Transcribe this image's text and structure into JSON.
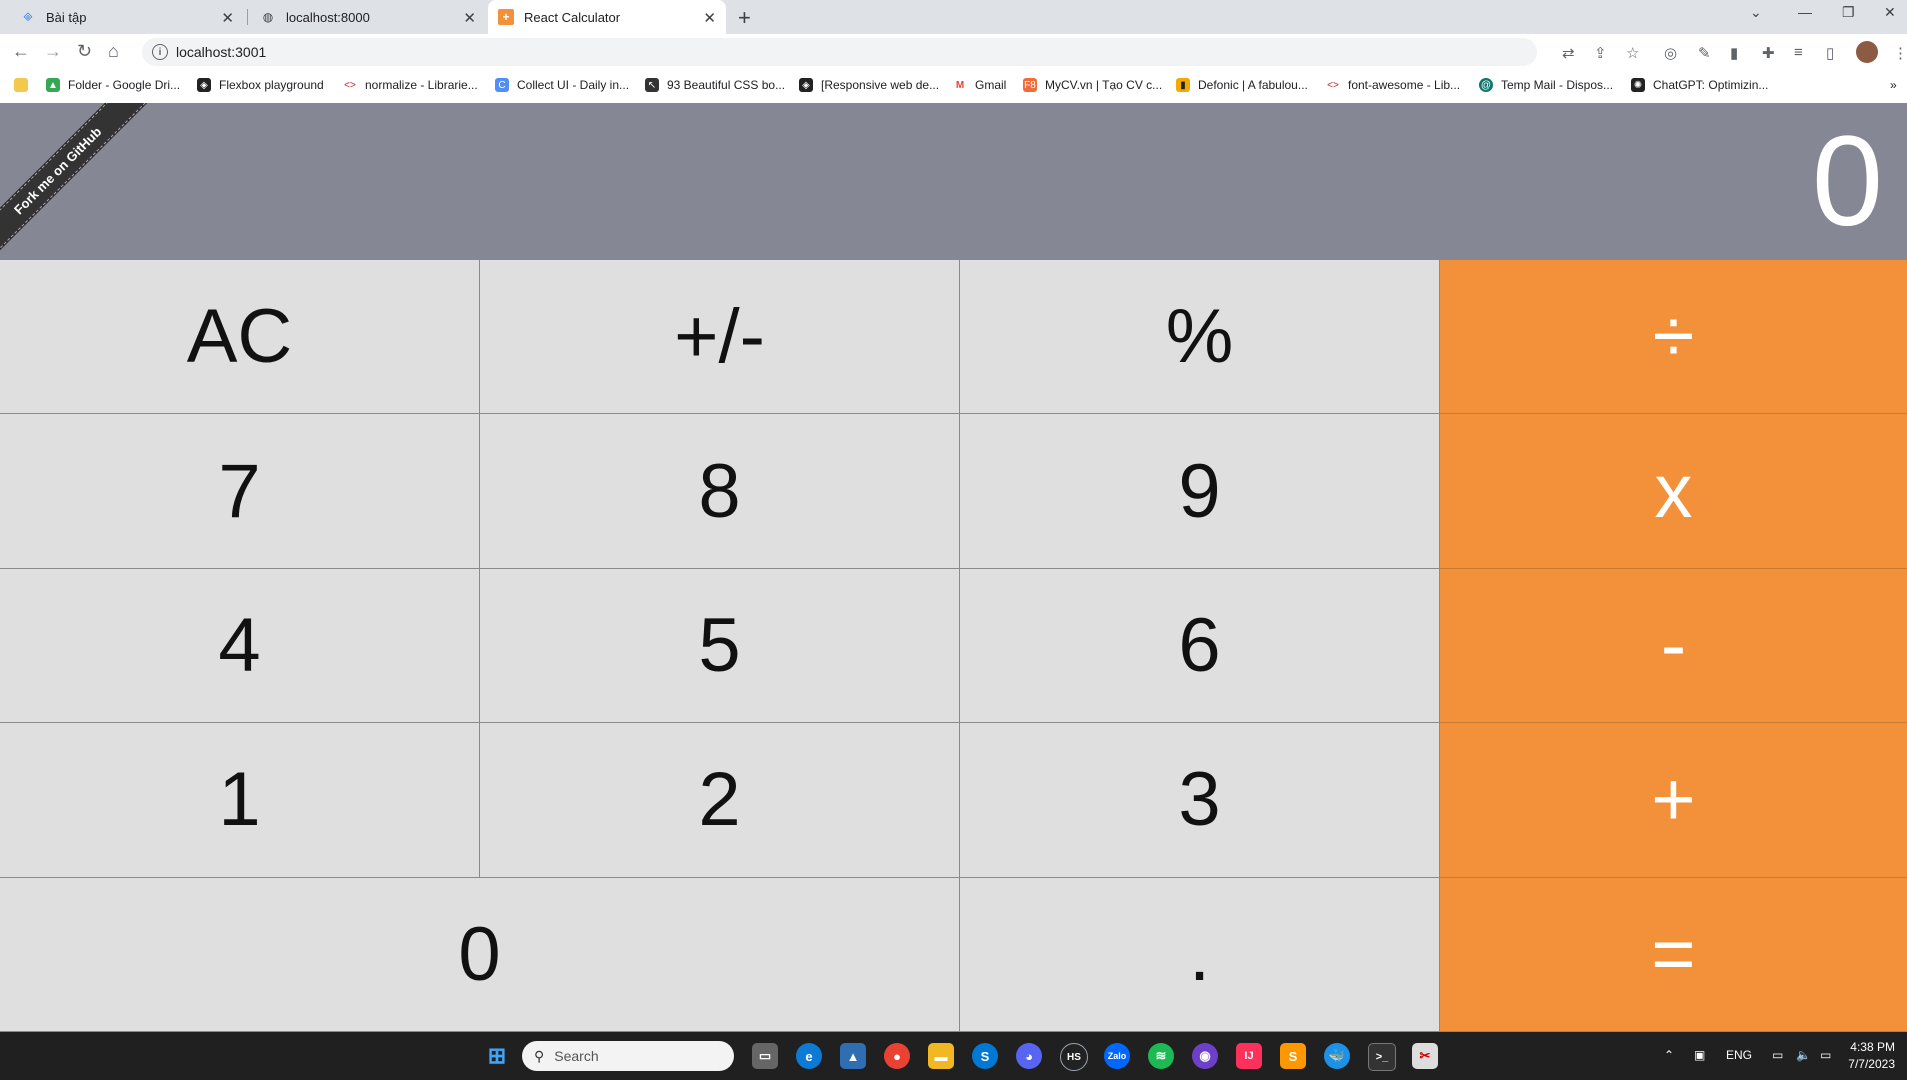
{
  "browser": {
    "tabs": [
      {
        "title": "Bài tập",
        "icon": "tree-icon",
        "active": false
      },
      {
        "title": "localhost:8000",
        "icon": "globe-icon",
        "active": false
      },
      {
        "title": "React Calculator",
        "icon": "calculator-icon",
        "active": true
      }
    ],
    "new_tab": "+",
    "address": "localhost:3001",
    "bookmarks": [
      {
        "label": "Folder - Google Dri...",
        "icon": "google-drive-icon"
      },
      {
        "label": "Flexbox playground",
        "icon": "flexbox-icon"
      },
      {
        "label": "normalize - Librarie...",
        "icon": "code-icon"
      },
      {
        "label": "Collect UI - Daily in...",
        "icon": "collectui-icon"
      },
      {
        "label": "93 Beautiful CSS bo...",
        "icon": "cursor-icon"
      },
      {
        "label": "[Responsive web de...",
        "icon": "flexbox-icon"
      },
      {
        "label": "Gmail",
        "icon": "gmail-icon"
      },
      {
        "label": "MyCV.vn | Tạo CV c...",
        "icon": "f8-icon"
      },
      {
        "label": "Defonic | A fabulou...",
        "icon": "defonic-icon"
      },
      {
        "label": "font-awesome - Lib...",
        "icon": "code-icon"
      },
      {
        "label": "Temp Mail - Dispos...",
        "icon": "tempmail-icon"
      },
      {
        "label": "ChatGPT: Optimizin...",
        "icon": "chatgpt-icon"
      }
    ]
  },
  "calculator": {
    "ribbon": "Fork me on GitHub",
    "display": "0",
    "keys": [
      {
        "label": "AC",
        "type": "func",
        "name": "clear-button"
      },
      {
        "label": "+/-",
        "type": "func",
        "name": "sign-toggle-button"
      },
      {
        "label": "%",
        "type": "func",
        "name": "percent-button"
      },
      {
        "label": "÷",
        "type": "op",
        "name": "divide-button"
      },
      {
        "label": "7",
        "type": "num",
        "name": "digit-7-button"
      },
      {
        "label": "8",
        "type": "num",
        "name": "digit-8-button"
      },
      {
        "label": "9",
        "type": "num",
        "name": "digit-9-button"
      },
      {
        "label": "x",
        "type": "op",
        "name": "multiply-button"
      },
      {
        "label": "4",
        "type": "num",
        "name": "digit-4-button"
      },
      {
        "label": "5",
        "type": "num",
        "name": "digit-5-button"
      },
      {
        "label": "6",
        "type": "num",
        "name": "digit-6-button"
      },
      {
        "label": "-",
        "type": "op",
        "name": "subtract-button"
      },
      {
        "label": "1",
        "type": "num",
        "name": "digit-1-button"
      },
      {
        "label": "2",
        "type": "num",
        "name": "digit-2-button"
      },
      {
        "label": "3",
        "type": "num",
        "name": "digit-3-button"
      },
      {
        "label": "+",
        "type": "op",
        "name": "add-button"
      },
      {
        "label": "0",
        "type": "zero",
        "name": "digit-0-button"
      },
      {
        "label": ".",
        "type": "num",
        "name": "decimal-button"
      },
      {
        "label": "=",
        "type": "op",
        "name": "equals-button"
      }
    ],
    "colors": {
      "display_bg": "#858794",
      "key_bg": "#dfdfdf",
      "operator_bg": "#f3913b"
    }
  },
  "taskbar": {
    "search_placeholder": "Search",
    "language": "ENG",
    "time": "4:38 PM",
    "date": "7/7/2023"
  }
}
